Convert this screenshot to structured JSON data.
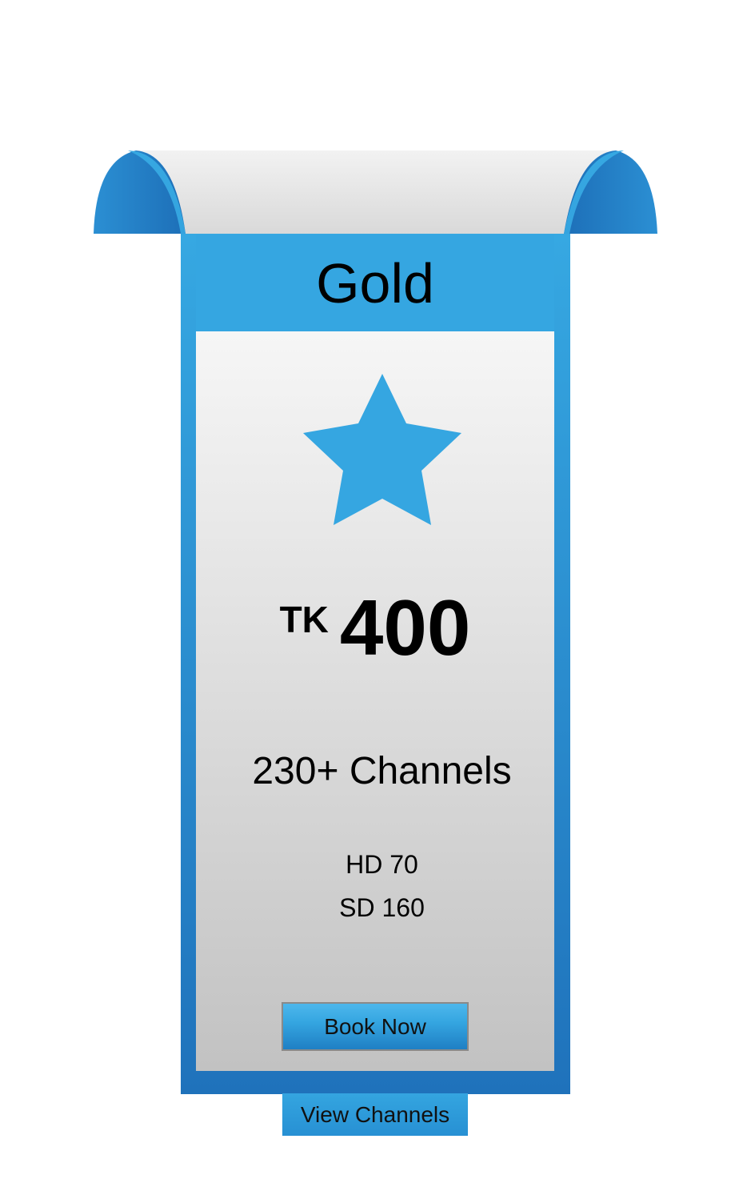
{
  "plan": {
    "name": "Gold",
    "currency": "TK",
    "price": "400",
    "channels_total": "230+ Channels",
    "hd": "HD 70",
    "sd": "SD 160"
  },
  "actions": {
    "book_now": "Book Now",
    "view_channels": "View Channels"
  },
  "icons": {
    "plan_icon": "star-icon"
  },
  "colors": {
    "accent": "#35a6e1",
    "accent_dark": "#1f72bb",
    "card_top": "#f5f5f5",
    "card_bottom": "#c4c4c4",
    "text": "#000000"
  }
}
